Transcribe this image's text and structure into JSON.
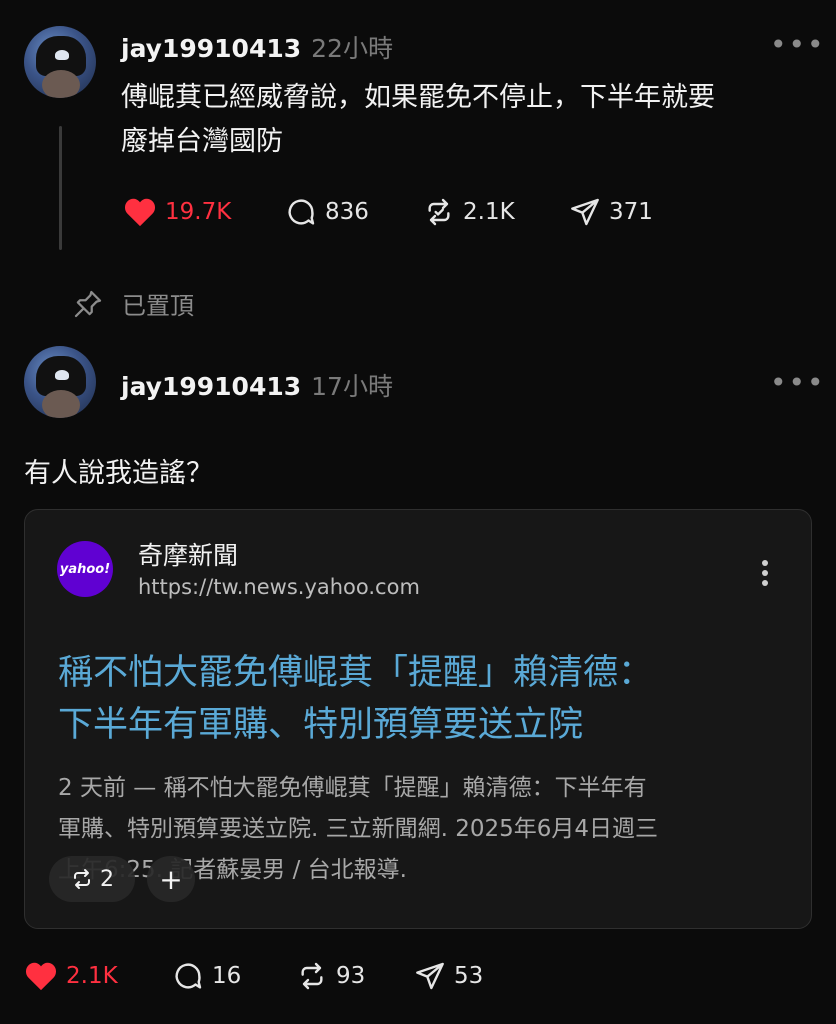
{
  "post1": {
    "username": "jay19910413",
    "time": "22小時",
    "more": "•••",
    "text_line1": "傅崐萁已經威脅說，如果罷免不停止，下半年就要",
    "text_line2": "廢掉台灣國防",
    "likes": "19.7K",
    "comments": "836",
    "reposts": "2.1K",
    "shares": "371"
  },
  "pinned_label": "已置頂",
  "post2": {
    "username": "jay19910413",
    "time": "17小時",
    "more": "•••",
    "text": "有人說我造謠？",
    "link_card": {
      "source_logo_text": "yahoo!",
      "source_name": "奇摩新聞",
      "source_url": "https://tw.news.yahoo.com",
      "headline_line1": "稱不怕大罷免傅崐萁「提醒」賴清德：",
      "headline_line2": "下半年有軍購、特別預算要送立院",
      "snippet_line1": "2 天前 — 稱不怕大罷免傅崐萁「提醒」賴清德：下半年有",
      "snippet_line2": "軍購、特別預算要送立院. 三立新聞網. 2025年6月4日週三",
      "snippet_line3": "上午6:25. 記者蘇晏男 / 台北報導.",
      "repost_chip_count": "2",
      "add_chip": "+"
    },
    "likes": "2.1K",
    "comments": "16",
    "reposts": "93",
    "shares": "53"
  },
  "colors": {
    "background": "#0b0b0b",
    "like_red": "#ff3040",
    "headline_blue": "#5aa9d6",
    "yahoo_purple": "#6001d2"
  }
}
